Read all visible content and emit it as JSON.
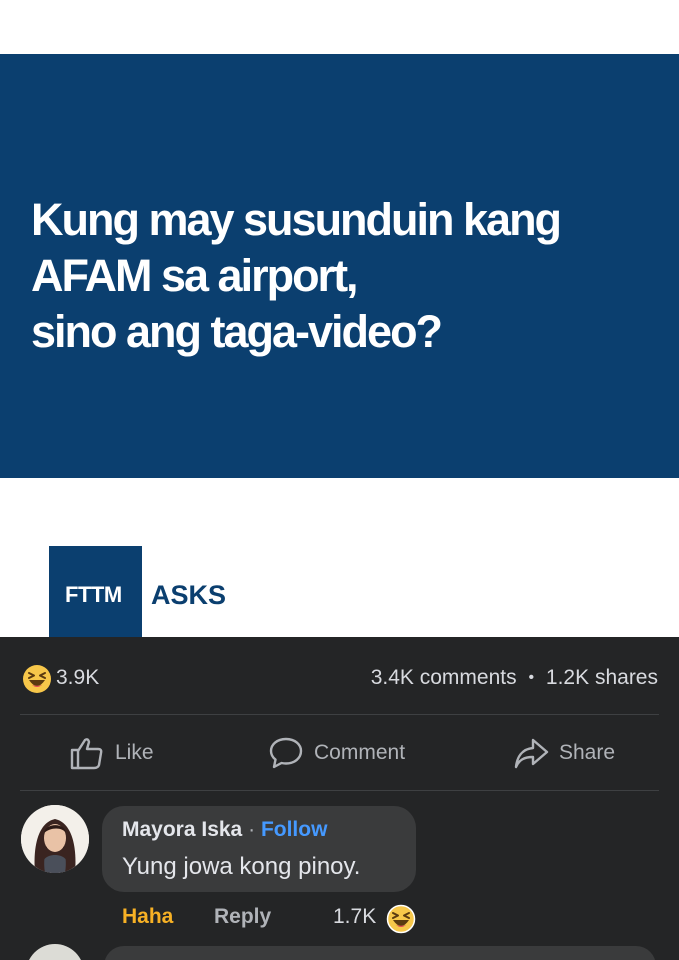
{
  "post": {
    "headline": [
      "Kung may susunduin kang",
      "AFAM sa airport,",
      "sino ang taga-video?"
    ],
    "logo": "FTTM",
    "tag": "ASKS",
    "brand_color": "#0b3f6f"
  },
  "stats": {
    "reaction_icon": "haha-emoji-icon",
    "reaction_count": "3.9K",
    "comments": "3.4K comments",
    "separator": "•",
    "shares": "1.2K shares"
  },
  "actions": {
    "like_label": "Like",
    "comment_label": "Comment",
    "share_label": "Share"
  },
  "comment": {
    "author": "Mayora Iska",
    "separator": "·",
    "follow_label": "Follow",
    "text": "Yung jowa kong pinoy.",
    "haha_label": "Haha",
    "reply_label": "Reply",
    "reaction_count": "1.7K",
    "reaction_icon": "haha-emoji-icon",
    "follow_color": "#4599ff",
    "haha_color": "#f7b125"
  }
}
